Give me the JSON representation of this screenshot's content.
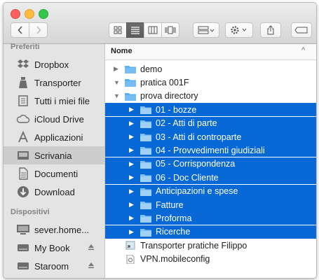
{
  "toolbar": {
    "back_icon": "chevron-left-icon",
    "forward_icon": "chevron-right-icon"
  },
  "sidebar": {
    "favorites_header": "Preferiti",
    "favorites": [
      {
        "label": "Dropbox",
        "icon": "dropbox-icon"
      },
      {
        "label": "Transporter",
        "icon": "transporter-icon"
      },
      {
        "label": "Tutti i miei file",
        "icon": "all-files-icon"
      },
      {
        "label": "iCloud Drive",
        "icon": "cloud-icon"
      },
      {
        "label": "Applicazioni",
        "icon": "applications-icon"
      },
      {
        "label": "Scrivania",
        "icon": "desktop-icon",
        "selected": true
      },
      {
        "label": "Documenti",
        "icon": "documents-icon"
      },
      {
        "label": "Download",
        "icon": "download-icon"
      }
    ],
    "devices_header": "Dispositivi",
    "devices": [
      {
        "label": "sever.home...",
        "icon": "computer-icon"
      },
      {
        "label": "My Book",
        "icon": "drive-icon",
        "eject": true
      },
      {
        "label": "Staroom",
        "icon": "drive-icon",
        "eject": true
      }
    ]
  },
  "list": {
    "column_name": "Nome",
    "sort_indicator": "^",
    "rows": [
      {
        "name": "demo",
        "expanded": false,
        "level": 0,
        "selected": false,
        "kind": "folder"
      },
      {
        "name": "pratica 001F",
        "expanded": true,
        "level": 0,
        "selected": false,
        "kind": "folder"
      },
      {
        "name": "prova directory",
        "expanded": true,
        "level": 0,
        "selected": false,
        "kind": "folder"
      },
      {
        "name": "01 - bozze",
        "expanded": false,
        "level": 1,
        "selected": true,
        "kind": "folder"
      },
      {
        "name": "02 - Atti di parte",
        "expanded": false,
        "level": 1,
        "selected": true,
        "kind": "folder"
      },
      {
        "name": "03 - Atti di controparte",
        "expanded": false,
        "level": 1,
        "selected": true,
        "kind": "folder"
      },
      {
        "name": "04 - Provvedimenti giudiziali",
        "expanded": false,
        "level": 1,
        "selected": true,
        "kind": "folder"
      },
      {
        "name": "05 - Corrispondenza",
        "expanded": false,
        "level": 1,
        "selected": true,
        "kind": "folder"
      },
      {
        "name": "06 - Doc Cliente",
        "expanded": false,
        "level": 1,
        "selected": true,
        "kind": "folder"
      },
      {
        "name": "Anticipazioni e spese",
        "expanded": false,
        "level": 1,
        "selected": true,
        "kind": "folder"
      },
      {
        "name": "Fatture",
        "expanded": false,
        "level": 1,
        "selected": true,
        "kind": "folder"
      },
      {
        "name": "Proforma",
        "expanded": false,
        "level": 1,
        "selected": true,
        "kind": "folder"
      },
      {
        "name": "Ricerche",
        "expanded": false,
        "level": 1,
        "selected": true,
        "kind": "folder"
      },
      {
        "name": "Transporter pratiche Filippo",
        "expanded": null,
        "level": 0,
        "selected": false,
        "kind": "alias"
      },
      {
        "name": "VPN.mobileconfig",
        "expanded": null,
        "level": 0,
        "selected": false,
        "kind": "file"
      }
    ]
  },
  "colors": {
    "selection": "#0869d6",
    "folder": "#5ab0f0",
    "sidebar_bg": "#e4e4e4"
  }
}
